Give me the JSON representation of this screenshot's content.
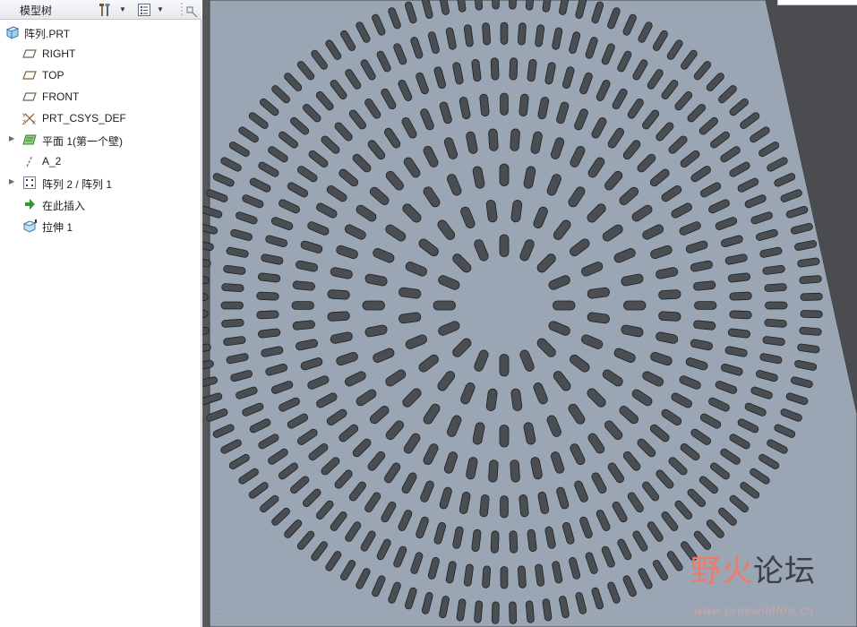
{
  "model_tree": {
    "title": "模型树",
    "items": [
      {
        "label": "阵列.PRT",
        "icon": "part-icon",
        "expandable": false
      },
      {
        "label": "RIGHT",
        "icon": "datum-plane-icon",
        "expandable": false
      },
      {
        "label": "TOP",
        "icon": "datum-plane-icon",
        "expandable": false
      },
      {
        "label": "FRONT",
        "icon": "datum-plane-icon",
        "expandable": false
      },
      {
        "label": "PRT_CSYS_DEF",
        "icon": "coordinate-system-icon",
        "expandable": false
      },
      {
        "label": "平面 1(第一个壁)",
        "icon": "sheetmetal-wall-icon",
        "expandable": true
      },
      {
        "label": "A_2",
        "icon": "datum-axis-icon",
        "expandable": false
      },
      {
        "label": "阵列 2 / 阵列 1",
        "icon": "pattern-icon",
        "expandable": true
      },
      {
        "label": "在此插入",
        "icon": "insert-here-arrow-icon",
        "expandable": false
      },
      {
        "label": "拉伸 1",
        "icon": "extrude-icon",
        "expandable": false
      }
    ]
  },
  "graphics": {
    "mode_text": "…",
    "background_color": "#555759",
    "sheet_color": "#9aa6b4",
    "slot_color": "#4a4d52",
    "pattern": {
      "ring_count": 8,
      "slots_per_ring": [
        16,
        24,
        32,
        48,
        64,
        80,
        96,
        112
      ]
    }
  },
  "watermark": {
    "title_part1": "野火",
    "title_part2": "论坛",
    "url": "www.proewildfire.cn"
  }
}
